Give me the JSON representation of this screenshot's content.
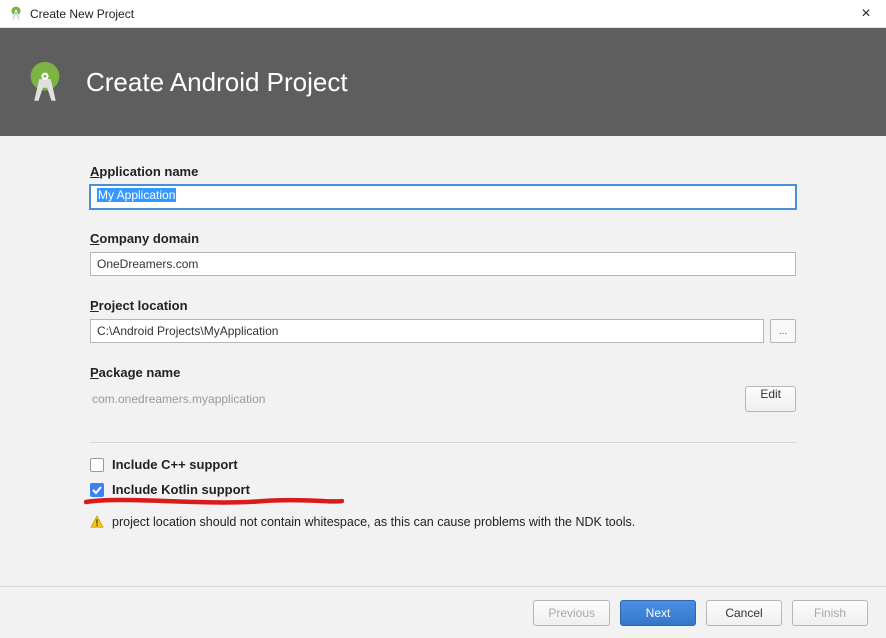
{
  "titlebar": {
    "title": "Create New Project"
  },
  "header": {
    "headline": "Create Android Project"
  },
  "labels": {
    "application_name": "pplication name",
    "company_domain": "ompany domain",
    "project_location": "roject location",
    "package_name": "ackage name",
    "app_prefix": "A",
    "company_prefix": "C",
    "proj_prefix": "P",
    "pkg_prefix": "P"
  },
  "fields": {
    "application_name": "My Application",
    "company_domain": "OneDreamers.com",
    "project_location": "C:\\Android Projects\\MyApplication",
    "package_name": "com.onedreamers.myapplication"
  },
  "buttons": {
    "browse": "...",
    "edit": "Edit",
    "previous": "Previous",
    "next": "Next",
    "cancel": "Cancel",
    "finish": "Finish"
  },
  "checkboxes": {
    "cpp": {
      "label": "Include C++ support",
      "checked": false
    },
    "kotlin": {
      "label": "Include Kotlin support",
      "checked": true
    }
  },
  "warning": "project location should not contain whitespace, as this can cause problems with the NDK tools."
}
